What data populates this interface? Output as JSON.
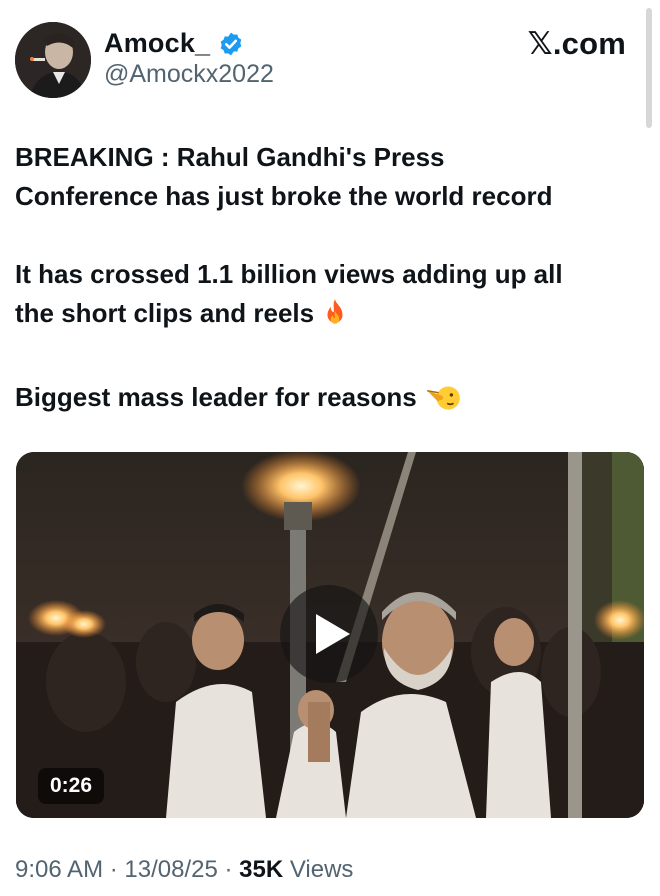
{
  "author": {
    "name": "Amock_",
    "handle": "@Amockx2022",
    "verified": true,
    "avatar_icon": "profile-photo"
  },
  "brand": {
    "label": "𝕏.com"
  },
  "tweet": {
    "line1": "BREAKING : Rahul Gandhi's Press",
    "line2": "Conference has just broke the world record",
    "line3": "It has crossed 1.1 billion views adding up all",
    "line4": "the short clips and reels",
    "line5": "Biggest mass leader for reasons",
    "emoji1": "fire-icon",
    "emoji2": "pointing-face-icon"
  },
  "media": {
    "type": "video",
    "duration": "0:26",
    "play_icon": "play-icon"
  },
  "meta": {
    "time": "9:06 AM",
    "sep1": " · ",
    "date": "13/08/25",
    "sep2": " · ",
    "views_count": "35K",
    "views_label": " Views"
  },
  "colors": {
    "text": "#0f1419",
    "muted": "#536471",
    "verified": "#1d9bf0"
  }
}
